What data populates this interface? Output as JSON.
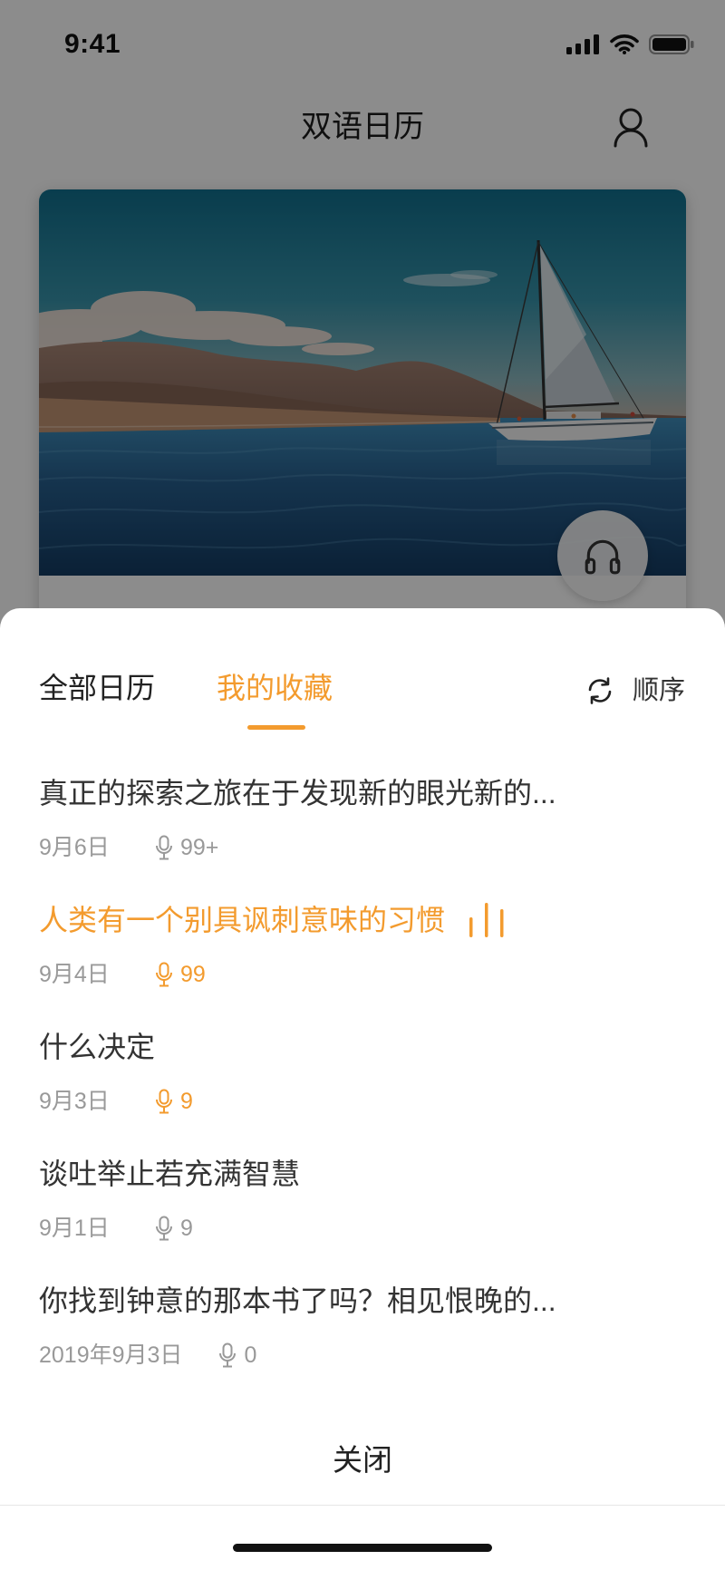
{
  "status_bar": {
    "time": "9:41",
    "icons": [
      "signal-icon",
      "wifi-icon",
      "battery-icon"
    ]
  },
  "header": {
    "title": "双语日历",
    "profile_icon": "user-icon"
  },
  "card": {
    "audio_icon": "headphones-icon"
  },
  "sheet": {
    "tabs": [
      {
        "label": "全部日历",
        "active": false
      },
      {
        "label": "我的收藏",
        "active": true
      }
    ],
    "sort": {
      "label": "顺序",
      "icon": "refresh-icon"
    },
    "items": [
      {
        "title": "真正的探索之旅在于发现新的眼光新的...",
        "date": "9月6日",
        "count": "99+",
        "title_highlighted": false,
        "count_highlighted": false,
        "playing": false
      },
      {
        "title": "人类有一个别具讽刺意味的习惯",
        "date": "9月4日",
        "count": "99",
        "title_highlighted": true,
        "count_highlighted": true,
        "playing": true
      },
      {
        "title": "什么决定",
        "date": "9月3日",
        "count": "9",
        "title_highlighted": false,
        "count_highlighted": true,
        "playing": false
      },
      {
        "title": "谈吐举止若充满智慧",
        "date": "9月1日",
        "count": "9",
        "title_highlighted": false,
        "count_highlighted": false,
        "playing": false
      },
      {
        "title": "你找到钟意的那本书了吗？相见恨晚的...",
        "date": "2019年9月3日",
        "count": "0",
        "title_highlighted": false,
        "count_highlighted": false,
        "playing": false
      }
    ],
    "close_label": "关闭"
  },
  "colors": {
    "accent": "#F39B2E",
    "text": "#333333",
    "meta": "#999999",
    "overlay": "rgba(0,0,0,0.45)"
  }
}
